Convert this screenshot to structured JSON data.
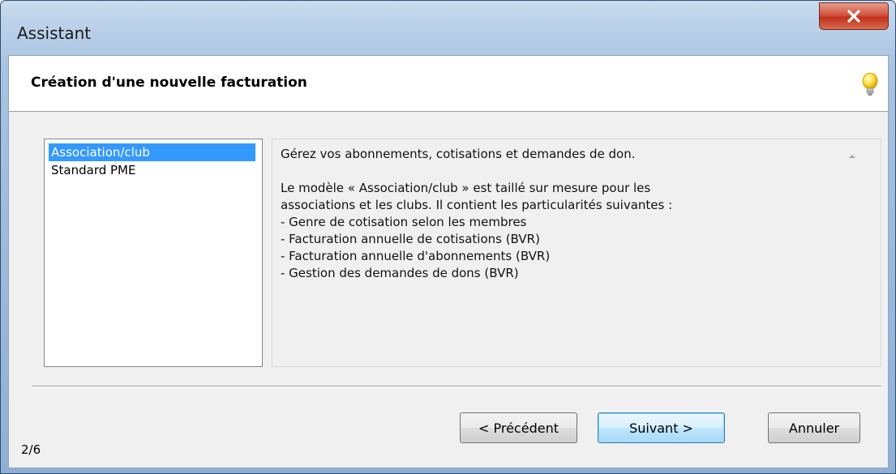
{
  "window": {
    "title": "Assistant",
    "close_icon": "close-x-icon"
  },
  "header": {
    "title": "Création d'une nouvelle facturation",
    "icon": "lightbulb-icon"
  },
  "templates": {
    "items": [
      {
        "label": "Association/club",
        "selected": true
      },
      {
        "label": "Standard PME",
        "selected": false
      }
    ]
  },
  "description": {
    "lines": [
      "Gérez vos abonnements, cotisations et demandes de don.",
      "",
      "Le modèle « Association/club » est taillé sur mesure pour les",
      "associations et les clubs. Il contient les particularités suivantes :",
      "- Genre de cotisation selon les membres",
      "- Facturation annuelle de cotisations (BVR)",
      "- Facturation annuelle d'abonnements (BVR)",
      "- Gestion des demandes de dons (BVR)"
    ],
    "scroll_icon": "scroll-up-arrow-icon"
  },
  "buttons": {
    "previous": "< Précédent",
    "next": "Suivant >",
    "cancel": "Annuler"
  },
  "step_indicator": "2/6",
  "colors": {
    "selection": "#3399ff",
    "dialog_bg": "#f0f0f0",
    "close_button": "#c0321b",
    "title_bar": "#bcd2ea"
  }
}
